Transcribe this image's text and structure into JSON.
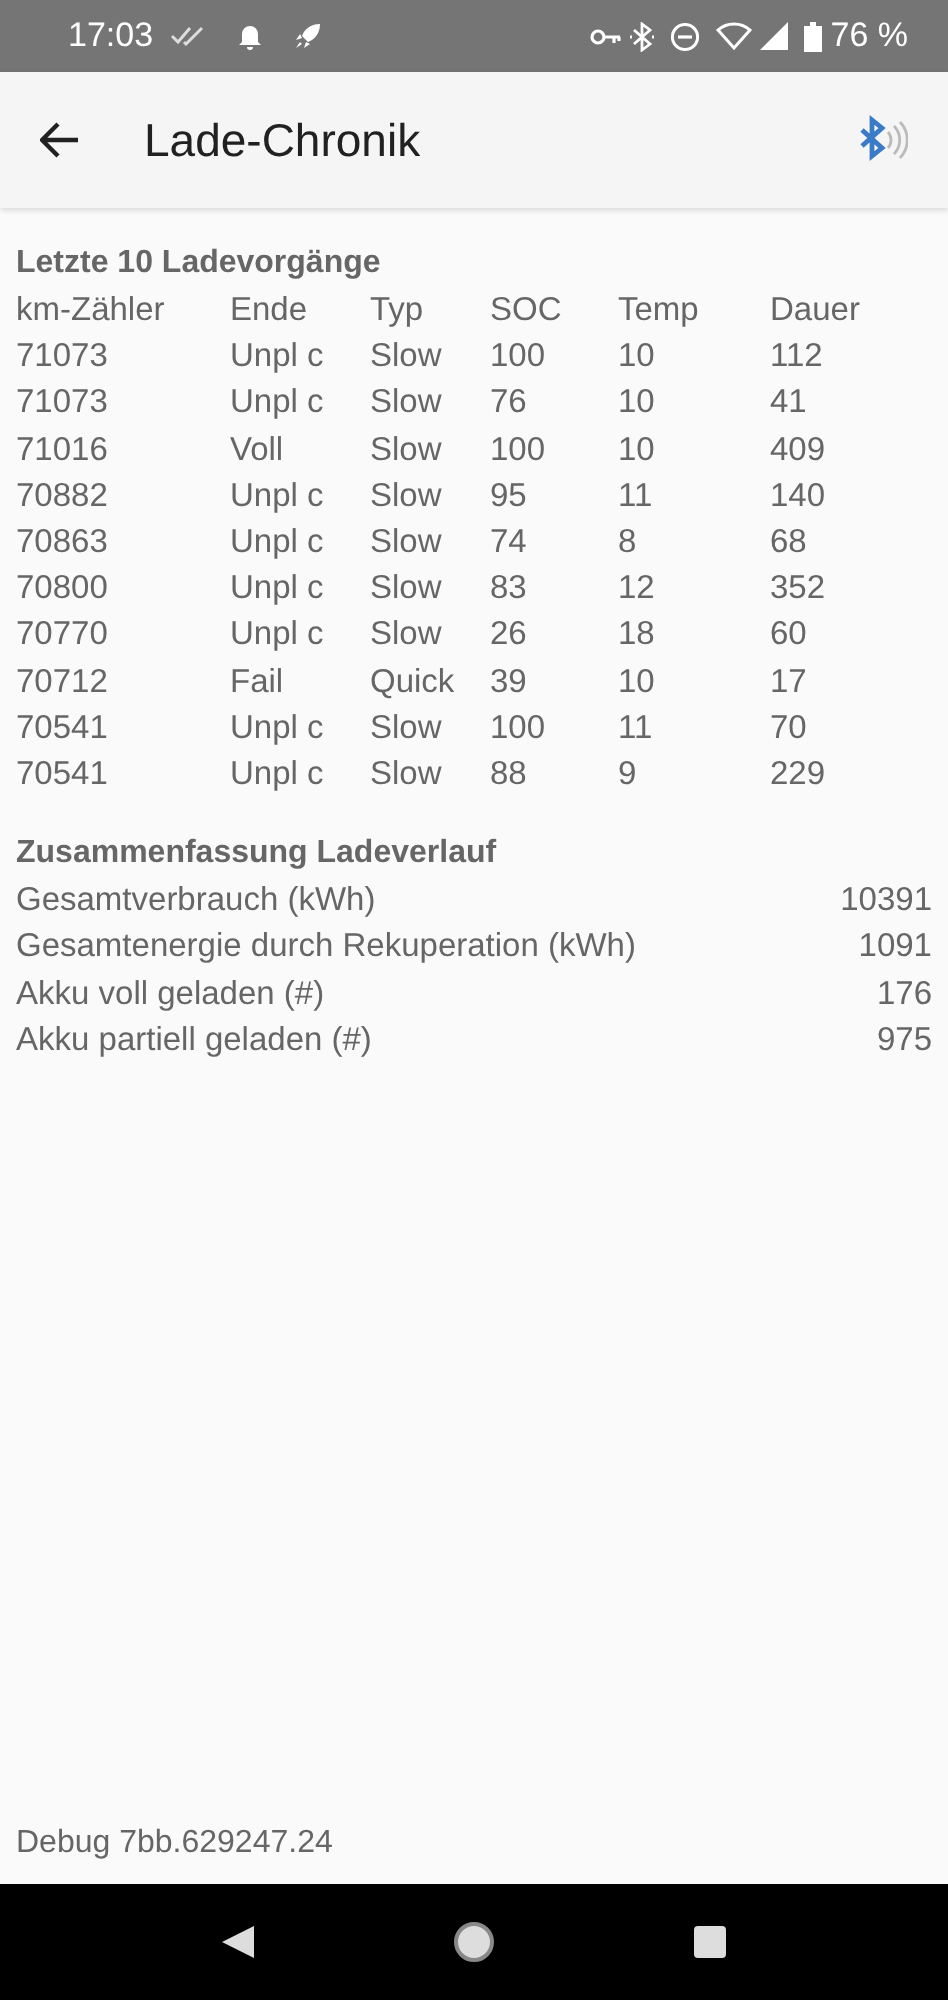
{
  "status_bar": {
    "time": "17:03",
    "battery": "76 %"
  },
  "app_bar": {
    "title": "Lade-Chronik"
  },
  "history": {
    "title": "Letzte 10 Ladevorgänge",
    "columns": [
      "km-Zähler",
      "Ende",
      "Typ",
      "SOC",
      "Temp",
      "Dauer"
    ],
    "rows": [
      [
        "71073",
        "Unpl c",
        "Slow",
        "100",
        "10",
        "112"
      ],
      [
        "71073",
        "Unpl c",
        "Slow",
        "76",
        "10",
        "41"
      ],
      [
        "71016",
        "Voll",
        "Slow",
        "100",
        "10",
        "409"
      ],
      [
        "70882",
        "Unpl c",
        "Slow",
        "95",
        "11",
        "140"
      ],
      [
        "70863",
        "Unpl c",
        "Slow",
        "74",
        "8",
        "68"
      ],
      [
        "70800",
        "Unpl c",
        "Slow",
        "83",
        "12",
        "352"
      ],
      [
        "70770",
        "Unpl c",
        "Slow",
        "26",
        "18",
        "60"
      ],
      [
        "70712",
        "Fail",
        "Quick",
        "39",
        "10",
        "17"
      ],
      [
        "70541",
        "Unpl c",
        "Slow",
        "100",
        "11",
        "70"
      ],
      [
        "70541",
        "Unpl c",
        "Slow",
        "88",
        "9",
        "229"
      ]
    ]
  },
  "summary": {
    "title": "Zusammenfassung Ladeverlauf",
    "items": [
      {
        "label": "Gesamtverbrauch (kWh)",
        "value": "10391"
      },
      {
        "label": "Gesamtenergie durch Rekuperation (kWh)",
        "value": "1091"
      },
      {
        "label": "Akku voll geladen (#)",
        "value": "176"
      },
      {
        "label": "Akku partiell geladen (#)",
        "value": "975"
      }
    ]
  },
  "debug": "Debug 7bb.629247.24"
}
